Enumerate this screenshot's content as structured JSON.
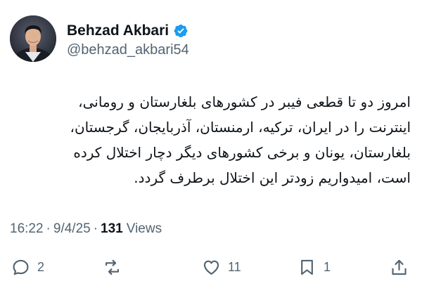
{
  "author": {
    "display_name": "Behzad Akbari",
    "handle": "@behzad_akbari54",
    "verified": true
  },
  "tweet": {
    "lines": [
      "امروز دو تا قطعی فیبر در کشورهای بلغارستان و رومانی،",
      "اینترنت را در ایران، ترکیه، ارمنستان، آذربایجان، گرجستان،",
      "بلغارستان، یونان و برخی کشورهای دیگر دچار اختلال کرده",
      "است، امیدواریم زودتر این اختلال برطرف گردد."
    ]
  },
  "meta": {
    "time": "16:22",
    "separator1": "·",
    "date": "9/4/25",
    "separator2": "·",
    "views_count": "131",
    "views_label": "Views"
  },
  "actions": {
    "reply_count": "2",
    "retweet_count": "",
    "like_count": "11",
    "bookmark_count": "1"
  },
  "colors": {
    "verified_badge": "#1d9bf0",
    "secondary_text": "#536471",
    "primary_text": "#0f1419"
  }
}
